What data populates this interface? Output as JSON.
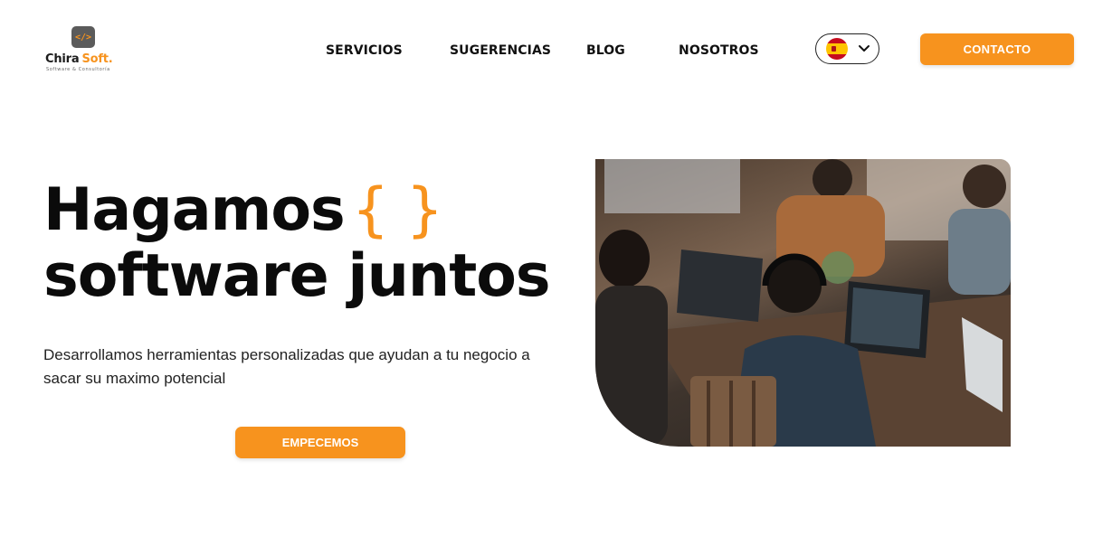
{
  "logo": {
    "badge": "</>",
    "name_part1": "Chira",
    "name_part2": "Soft.",
    "tagline": "Software & Consultoría"
  },
  "nav": {
    "items": [
      {
        "label": "SERVICIOS"
      },
      {
        "label": "SUGERENCIAS"
      },
      {
        "label": "BLOG"
      },
      {
        "label": "NOSOTROS"
      }
    ],
    "language": {
      "icon": "spain-flag-icon",
      "dropdown_icon": "chevron-down-icon"
    },
    "contact_label": "CONTACTO"
  },
  "hero": {
    "title_line1": "Hagamos",
    "title_braces": "{ }",
    "title_line2": "software juntos",
    "subtitle": "Desarrollamos herramientas personalizadas que ayudan  a tu negocio a sacar su maximo potencial",
    "cta_label": "EMPECEMOS",
    "image_description": "people-working-on-laptops-photo"
  },
  "colors": {
    "accent": "#f7931e",
    "text": "#0b0b0b",
    "background": "#ffffff"
  }
}
